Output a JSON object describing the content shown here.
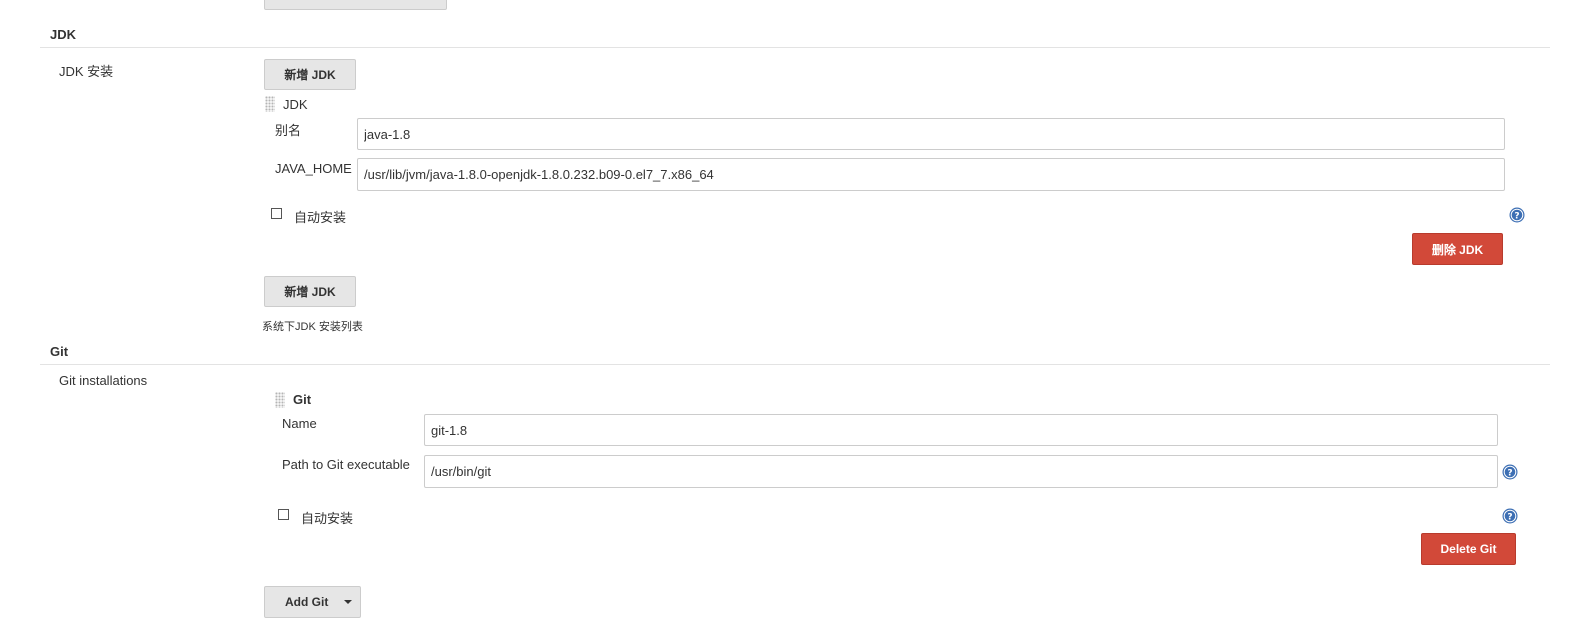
{
  "jdk_section": {
    "title": "JDK",
    "field_label": "JDK 安装",
    "add_button_label": "新增 JDK",
    "entry": {
      "header": "JDK",
      "alias_label": "别名",
      "alias_value": "java-1.8",
      "java_home_label": "JAVA_HOME",
      "java_home_value": "/usr/lib/jvm/java-1.8.0-openjdk-1.8.0.232.b09-0.el7_7.x86_64",
      "auto_install_label": "自动安装",
      "delete_button_label": "删除 JDK"
    },
    "add_button_bottom_label": "新增 JDK",
    "description": "系统下JDK 安装列表"
  },
  "git_section": {
    "title": "Git",
    "field_label": "Git installations",
    "entry": {
      "header": "Git",
      "name_label": "Name",
      "name_value": "git-1.8",
      "path_label": "Path to Git executable",
      "path_value": "/usr/bin/git",
      "auto_install_label": "自动安装",
      "delete_button_label": "Delete Git"
    },
    "add_button_label": "Add Git"
  },
  "colors": {
    "delete_button": "#d24939",
    "help_icon": "#3d6fb4",
    "gray_button": "#e6e6e6"
  }
}
